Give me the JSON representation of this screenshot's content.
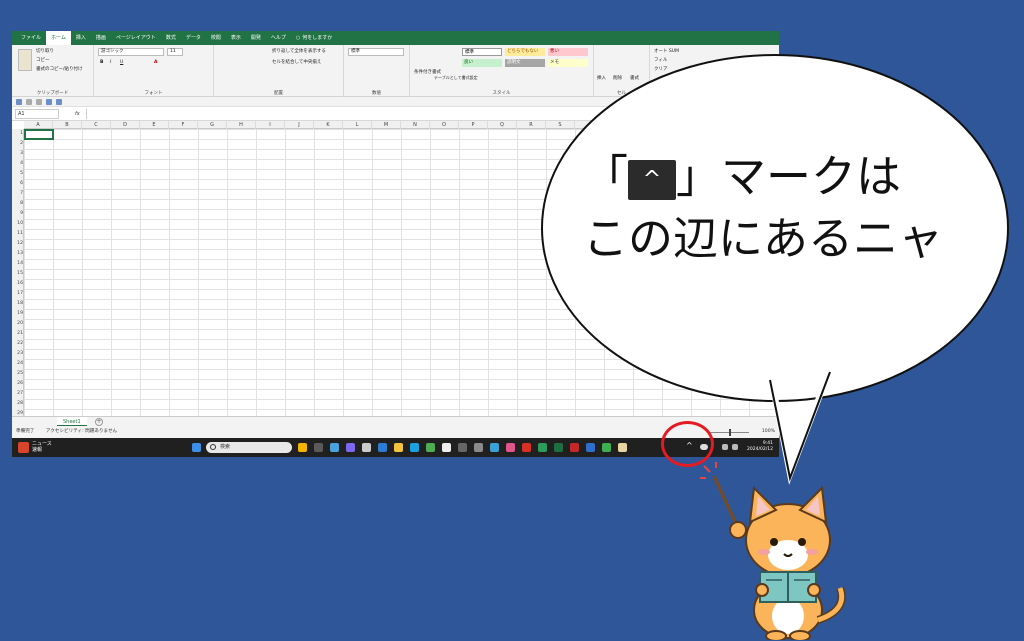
{
  "excel": {
    "tabs": [
      "ファイル",
      "ホーム",
      "挿入",
      "描画",
      "ページレイアウト",
      "数式",
      "データ",
      "校閲",
      "表示",
      "開発",
      "ヘルプ",
      "何をしますか"
    ],
    "active_tab": "ホーム",
    "clipboard": {
      "cut": "切り取り",
      "copy": "コピー",
      "format_painter": "書式のコピー/貼り付け",
      "group": "クリップボード"
    },
    "font": {
      "name": "游ゴシック",
      "size": "11",
      "group": "フォント"
    },
    "alignment": {
      "wrap": "折り返して全体を表示する",
      "merge": "セルを結合して中央揃え",
      "group": "配置"
    },
    "number": {
      "format": "標準",
      "group": "数値"
    },
    "styles": {
      "cond": "条件付き書式",
      "table": "テーブルとして書式設定",
      "normal": "標準",
      "bad": "どちらでもない",
      "good": "良い",
      "neutral": "悪い",
      "calc": "説明文",
      "memo": "メモ",
      "group": "スタイル"
    },
    "cells_group": {
      "insert": "挿入",
      "delete": "削除",
      "format": "書式",
      "group": "セル"
    },
    "editing": {
      "autosum": "オート SUM",
      "fill": "フィル",
      "clear": "クリア"
    },
    "namebox": "A1",
    "fx": "fx",
    "columns": [
      "A",
      "B",
      "C",
      "D",
      "E",
      "F",
      "G",
      "H",
      "I",
      "J",
      "K",
      "L",
      "M",
      "N",
      "O",
      "P",
      "Q",
      "R",
      "S"
    ],
    "rows": [
      "1",
      "2",
      "3",
      "4",
      "5",
      "6",
      "7",
      "8",
      "9",
      "10",
      "11",
      "12",
      "13",
      "14",
      "15",
      "16",
      "17",
      "18",
      "19",
      "20",
      "21",
      "22",
      "23",
      "24",
      "25",
      "26",
      "27",
      "28",
      "29"
    ],
    "sheet_tab": "Sheet1",
    "add_sheet": "+",
    "status_left": "準備完了",
    "status_access": "アクセシビリティ: 問題ありません",
    "status_zoom": "100%"
  },
  "taskbar": {
    "news": "ニュース",
    "news2": "速報",
    "search_placeholder": "検索",
    "tray_chevron": "^",
    "time": "9:41",
    "date": "2024/02/12"
  },
  "callout": {
    "line1_open": "「",
    "key_glyph": "^",
    "line1_close": "」マークは",
    "line2": "この辺にあるニャ"
  },
  "colors": {
    "background": "#2e5699",
    "excel_green": "#217346",
    "highlight_circle": "#e31b23"
  }
}
